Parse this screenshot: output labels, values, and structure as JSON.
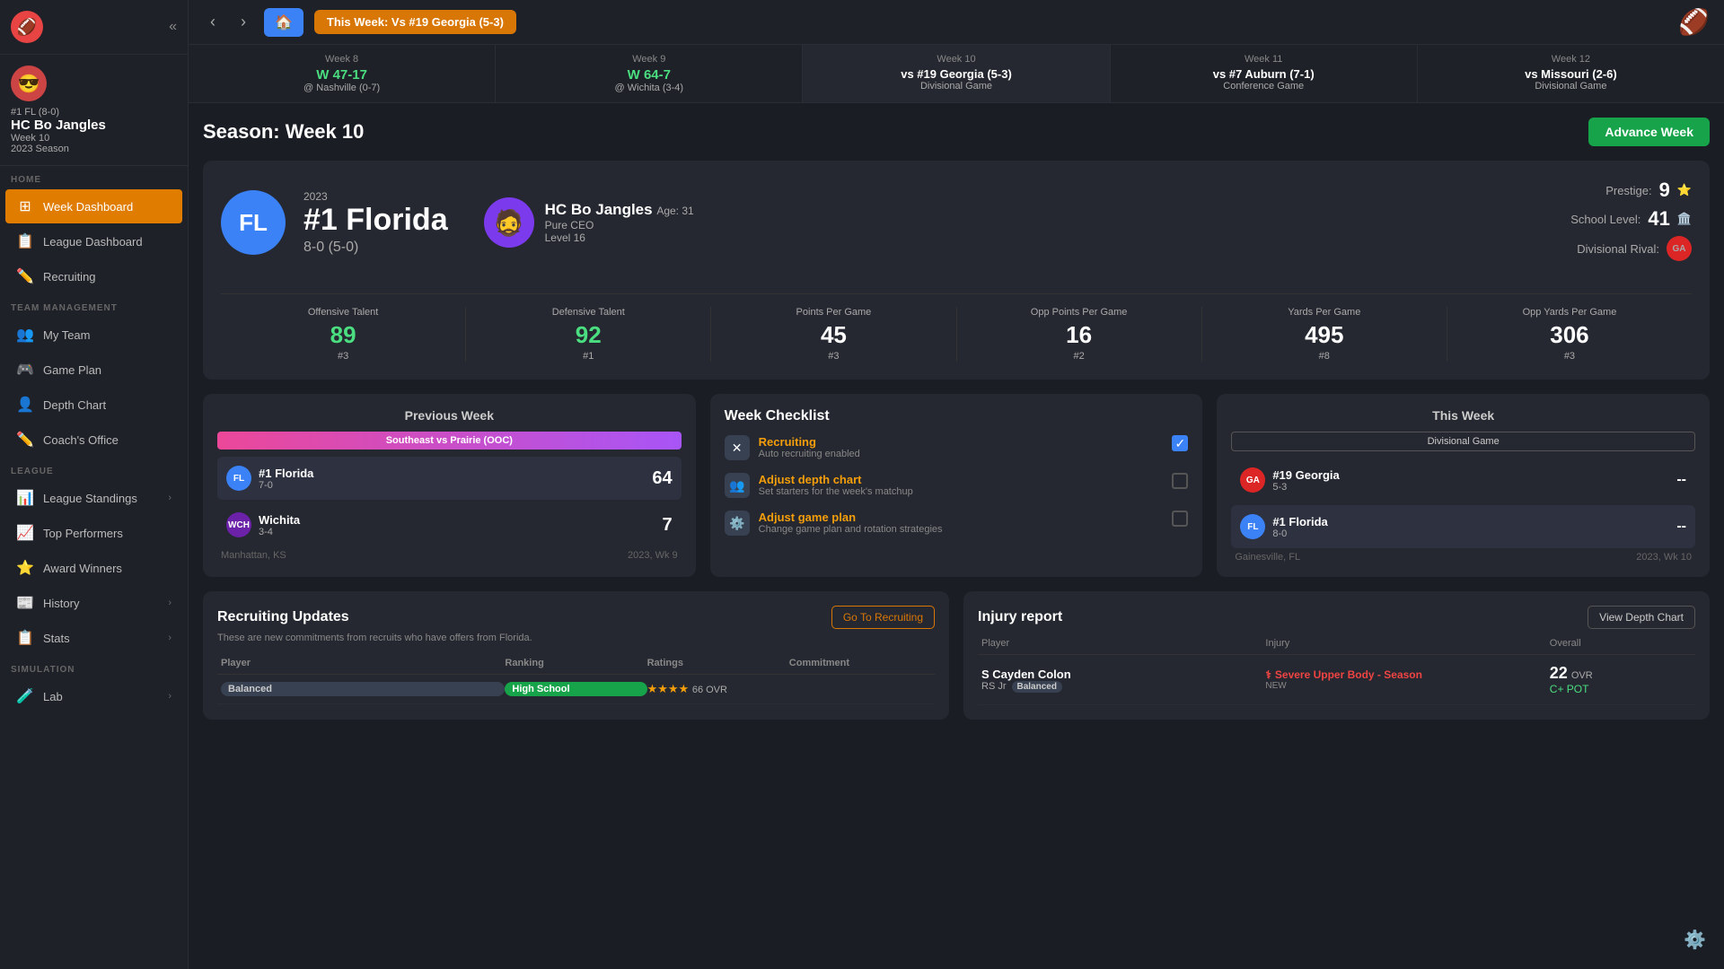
{
  "sidebar": {
    "logo": "🏈",
    "collapse_icon": "«",
    "user": {
      "rank": "#1 FL (8-0)",
      "name": "HC Bo Jangles",
      "week": "Week 10",
      "season": "2023 Season",
      "avatar": "😎"
    },
    "sections": [
      {
        "label": "HOME",
        "items": [
          {
            "id": "week-dashboard",
            "icon": "⊞",
            "label": "Week Dashboard",
            "active": true
          },
          {
            "id": "league-dashboard",
            "icon": "📋",
            "label": "League Dashboard",
            "active": false
          },
          {
            "id": "recruiting",
            "icon": "✏️",
            "label": "Recruiting",
            "active": false
          }
        ]
      },
      {
        "label": "TEAM MANAGEMENT",
        "items": [
          {
            "id": "my-team",
            "icon": "👥",
            "label": "My Team",
            "active": false
          },
          {
            "id": "game-plan",
            "icon": "🎮",
            "label": "Game Plan",
            "active": false
          },
          {
            "id": "depth-chart",
            "icon": "👤",
            "label": "Depth Chart",
            "active": false
          },
          {
            "id": "coaches-office",
            "icon": "✏️",
            "label": "Coach's Office",
            "active": false
          }
        ]
      },
      {
        "label": "LEAGUE",
        "items": [
          {
            "id": "league-standings",
            "icon": "📊",
            "label": "League Standings",
            "active": false,
            "chevron": "›"
          },
          {
            "id": "top-performers",
            "icon": "📈",
            "label": "Top Performers",
            "active": false
          },
          {
            "id": "award-winners",
            "icon": "⭐",
            "label": "Award Winners",
            "active": false
          },
          {
            "id": "history",
            "icon": "📰",
            "label": "History",
            "active": false,
            "chevron": "›"
          },
          {
            "id": "stats",
            "icon": "📋",
            "label": "Stats",
            "active": false,
            "chevron": "›"
          }
        ]
      },
      {
        "label": "SIMULATION",
        "items": [
          {
            "id": "lab",
            "icon": "🧪",
            "label": "Lab",
            "active": false,
            "chevron": "›"
          }
        ]
      }
    ]
  },
  "topnav": {
    "back_icon": "‹",
    "forward_icon": "›",
    "home_icon": "🏠",
    "week_badge": "This Week: Vs #19 Georgia (5-3)",
    "football": "🏈"
  },
  "schedule": [
    {
      "week": "Week 8",
      "score": "W 47-17",
      "win": true,
      "opp": "@ Nashville (0-7)"
    },
    {
      "week": "Week 9",
      "score": "W 64-7",
      "win": true,
      "opp": "@ Wichita (3-4)"
    },
    {
      "week": "Week 10",
      "current": true,
      "matchup": "vs #19 Georgia (5-3)",
      "sub": "Divisional Game"
    },
    {
      "week": "Week 11",
      "matchup": "vs #7 Auburn (7-1)",
      "sub": "Conference Game"
    },
    {
      "week": "Week 12",
      "matchup": "vs Missouri (2-6)",
      "sub": "Divisional Game"
    }
  ],
  "season": {
    "title": "Season: Week 10",
    "advance_btn": "Advance Week"
  },
  "team": {
    "year": "2023",
    "abbr": "FL",
    "name": "#1 Florida",
    "record": "8-0 (5-0)",
    "logo_bg": "#3b82f6"
  },
  "coach": {
    "name": "HC Bo Jangles",
    "age": "Age: 31",
    "title": "Pure CEO",
    "level": "Level 16",
    "avatar": "🧔"
  },
  "prestige": {
    "label": "Prestige:",
    "value": "9",
    "star": "⭐",
    "school_label": "School Level:",
    "school_value": "41",
    "school_icon": "🏛️",
    "rival_label": "Divisional Rival:",
    "rival_abbr": "GA"
  },
  "stats": [
    {
      "label": "Offensive Talent",
      "value": "89",
      "rank": "#3",
      "green": true
    },
    {
      "label": "Defensive Talent",
      "value": "92",
      "rank": "#1",
      "green": true
    },
    {
      "label": "Points Per Game",
      "value": "45",
      "rank": "#3",
      "green": false
    },
    {
      "label": "Opp Points Per Game",
      "value": "16",
      "rank": "#2",
      "green": false
    },
    {
      "label": "Yards Per Game",
      "value": "495",
      "rank": "#8",
      "green": false
    },
    {
      "label": "Opp Yards Per Game",
      "value": "306",
      "rank": "#3",
      "green": false
    }
  ],
  "previous_week": {
    "title": "Previous Week",
    "game_label": "Southeast vs Prairie (OOC)",
    "team1": {
      "abbr": "FL",
      "name": "#1 Florida",
      "record": "7-0",
      "score": "64",
      "winner": true,
      "bg": "#3b82f6"
    },
    "team2": {
      "abbr": "WCH",
      "name": "Wichita",
      "record": "3-4",
      "score": "7",
      "winner": false,
      "bg": "#6b21a8"
    },
    "location": "Manhattan, KS",
    "week_ref": "2023, Wk 9"
  },
  "checklist": {
    "title": "Week Checklist",
    "items": [
      {
        "icon": "✕",
        "label": "Recruiting",
        "sub": "Auto recruiting enabled",
        "done": true
      },
      {
        "icon": "👥",
        "label": "Adjust depth chart",
        "sub": "Set starters for the week's matchup",
        "done": false
      },
      {
        "icon": "⚙️",
        "label": "Adjust game plan",
        "sub": "Change game plan and rotation strategies",
        "done": false
      }
    ]
  },
  "this_week": {
    "title": "This Week",
    "game_label": "Divisional Game",
    "team1": {
      "abbr": "GA",
      "name": "#19 Georgia",
      "record": "5-3",
      "score": "--",
      "bg": "#dc2626"
    },
    "team2": {
      "abbr": "FL",
      "name": "#1 Florida",
      "record": "8-0",
      "score": "--",
      "winner": true,
      "bg": "#3b82f6"
    },
    "location": "Gainesville, FL",
    "week_ref": "2023, Wk 10"
  },
  "recruiting": {
    "title": "Recruiting Updates",
    "sub": "These are new commitments from recruits who have offers from Florida.",
    "btn": "Go To Recruiting",
    "columns": [
      "Player",
      "Ranking",
      "Ratings",
      "Commitment"
    ],
    "rows": [
      {
        "name": "...",
        "tag": "Balanced",
        "ranking": "High School",
        "stars": "★★★★",
        "ovr": "66",
        "commitment": ""
      }
    ]
  },
  "injury": {
    "title": "Injury report",
    "btn": "View Depth Chart",
    "columns": [
      "Player",
      "Injury",
      "Overall"
    ],
    "rows": [
      {
        "name": "S Cayden Colon",
        "pos": "RS Jr",
        "tag": "Balanced",
        "injury": "Severe Upper Body - Season",
        "new": "NEW",
        "ovr": "22",
        "pot": "C+ POT"
      }
    ]
  }
}
